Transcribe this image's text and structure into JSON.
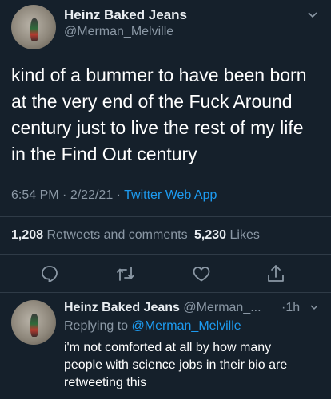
{
  "main_tweet": {
    "display_name": "Heinz Baked Jeans",
    "handle": "@Merman_Melville",
    "text_lines": [
      "kind of a bummer to have been born",
      "at the very end of the Fuck Around",
      "century just to live the rest of my life",
      "in the Find Out century"
    ],
    "time": "6:54 PM",
    "date": "2/22/21",
    "app": "Twitter Web App",
    "retweets_count": "1,208",
    "retweets_label": "Retweets and comments",
    "likes_count": "5,230",
    "likes_label": "Likes",
    "sep": "·"
  },
  "reply": {
    "display_name": "Heinz Baked Jeans",
    "handle": "@Merman_...",
    "age": "·1h",
    "replying_to_label": "Replying to",
    "replying_to_handle": "@Merman_Melville",
    "text_lines": [
      "i'm not comforted at all by how many",
      "people with science jobs in their bio are",
      "retweeting this"
    ]
  },
  "icons": {
    "reply": "reply-icon",
    "retweet": "retweet-icon",
    "like": "heart-icon",
    "share": "share-icon",
    "more": "chevron-down-icon"
  },
  "colors": {
    "background": "#15202b",
    "link": "#1d9bf0",
    "muted": "#8b98a5"
  }
}
